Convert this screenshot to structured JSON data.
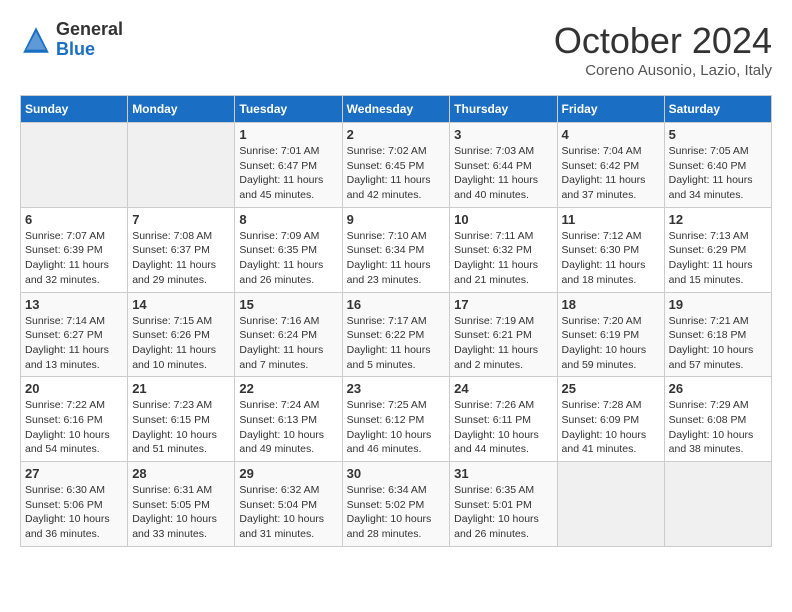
{
  "header": {
    "logo_general": "General",
    "logo_blue": "Blue",
    "month_title": "October 2024",
    "location": "Coreno Ausonio, Lazio, Italy"
  },
  "calendar": {
    "days_of_week": [
      "Sunday",
      "Monday",
      "Tuesday",
      "Wednesday",
      "Thursday",
      "Friday",
      "Saturday"
    ],
    "weeks": [
      [
        {
          "day": "",
          "info": ""
        },
        {
          "day": "",
          "info": ""
        },
        {
          "day": "1",
          "info": "Sunrise: 7:01 AM\nSunset: 6:47 PM\nDaylight: 11 hours and 45 minutes."
        },
        {
          "day": "2",
          "info": "Sunrise: 7:02 AM\nSunset: 6:45 PM\nDaylight: 11 hours and 42 minutes."
        },
        {
          "day": "3",
          "info": "Sunrise: 7:03 AM\nSunset: 6:44 PM\nDaylight: 11 hours and 40 minutes."
        },
        {
          "day": "4",
          "info": "Sunrise: 7:04 AM\nSunset: 6:42 PM\nDaylight: 11 hours and 37 minutes."
        },
        {
          "day": "5",
          "info": "Sunrise: 7:05 AM\nSunset: 6:40 PM\nDaylight: 11 hours and 34 minutes."
        }
      ],
      [
        {
          "day": "6",
          "info": "Sunrise: 7:07 AM\nSunset: 6:39 PM\nDaylight: 11 hours and 32 minutes."
        },
        {
          "day": "7",
          "info": "Sunrise: 7:08 AM\nSunset: 6:37 PM\nDaylight: 11 hours and 29 minutes."
        },
        {
          "day": "8",
          "info": "Sunrise: 7:09 AM\nSunset: 6:35 PM\nDaylight: 11 hours and 26 minutes."
        },
        {
          "day": "9",
          "info": "Sunrise: 7:10 AM\nSunset: 6:34 PM\nDaylight: 11 hours and 23 minutes."
        },
        {
          "day": "10",
          "info": "Sunrise: 7:11 AM\nSunset: 6:32 PM\nDaylight: 11 hours and 21 minutes."
        },
        {
          "day": "11",
          "info": "Sunrise: 7:12 AM\nSunset: 6:30 PM\nDaylight: 11 hours and 18 minutes."
        },
        {
          "day": "12",
          "info": "Sunrise: 7:13 AM\nSunset: 6:29 PM\nDaylight: 11 hours and 15 minutes."
        }
      ],
      [
        {
          "day": "13",
          "info": "Sunrise: 7:14 AM\nSunset: 6:27 PM\nDaylight: 11 hours and 13 minutes."
        },
        {
          "day": "14",
          "info": "Sunrise: 7:15 AM\nSunset: 6:26 PM\nDaylight: 11 hours and 10 minutes."
        },
        {
          "day": "15",
          "info": "Sunrise: 7:16 AM\nSunset: 6:24 PM\nDaylight: 11 hours and 7 minutes."
        },
        {
          "day": "16",
          "info": "Sunrise: 7:17 AM\nSunset: 6:22 PM\nDaylight: 11 hours and 5 minutes."
        },
        {
          "day": "17",
          "info": "Sunrise: 7:19 AM\nSunset: 6:21 PM\nDaylight: 11 hours and 2 minutes."
        },
        {
          "day": "18",
          "info": "Sunrise: 7:20 AM\nSunset: 6:19 PM\nDaylight: 10 hours and 59 minutes."
        },
        {
          "day": "19",
          "info": "Sunrise: 7:21 AM\nSunset: 6:18 PM\nDaylight: 10 hours and 57 minutes."
        }
      ],
      [
        {
          "day": "20",
          "info": "Sunrise: 7:22 AM\nSunset: 6:16 PM\nDaylight: 10 hours and 54 minutes."
        },
        {
          "day": "21",
          "info": "Sunrise: 7:23 AM\nSunset: 6:15 PM\nDaylight: 10 hours and 51 minutes."
        },
        {
          "day": "22",
          "info": "Sunrise: 7:24 AM\nSunset: 6:13 PM\nDaylight: 10 hours and 49 minutes."
        },
        {
          "day": "23",
          "info": "Sunrise: 7:25 AM\nSunset: 6:12 PM\nDaylight: 10 hours and 46 minutes."
        },
        {
          "day": "24",
          "info": "Sunrise: 7:26 AM\nSunset: 6:11 PM\nDaylight: 10 hours and 44 minutes."
        },
        {
          "day": "25",
          "info": "Sunrise: 7:28 AM\nSunset: 6:09 PM\nDaylight: 10 hours and 41 minutes."
        },
        {
          "day": "26",
          "info": "Sunrise: 7:29 AM\nSunset: 6:08 PM\nDaylight: 10 hours and 38 minutes."
        }
      ],
      [
        {
          "day": "27",
          "info": "Sunrise: 6:30 AM\nSunset: 5:06 PM\nDaylight: 10 hours and 36 minutes."
        },
        {
          "day": "28",
          "info": "Sunrise: 6:31 AM\nSunset: 5:05 PM\nDaylight: 10 hours and 33 minutes."
        },
        {
          "day": "29",
          "info": "Sunrise: 6:32 AM\nSunset: 5:04 PM\nDaylight: 10 hours and 31 minutes."
        },
        {
          "day": "30",
          "info": "Sunrise: 6:34 AM\nSunset: 5:02 PM\nDaylight: 10 hours and 28 minutes."
        },
        {
          "day": "31",
          "info": "Sunrise: 6:35 AM\nSunset: 5:01 PM\nDaylight: 10 hours and 26 minutes."
        },
        {
          "day": "",
          "info": ""
        },
        {
          "day": "",
          "info": ""
        }
      ]
    ]
  }
}
